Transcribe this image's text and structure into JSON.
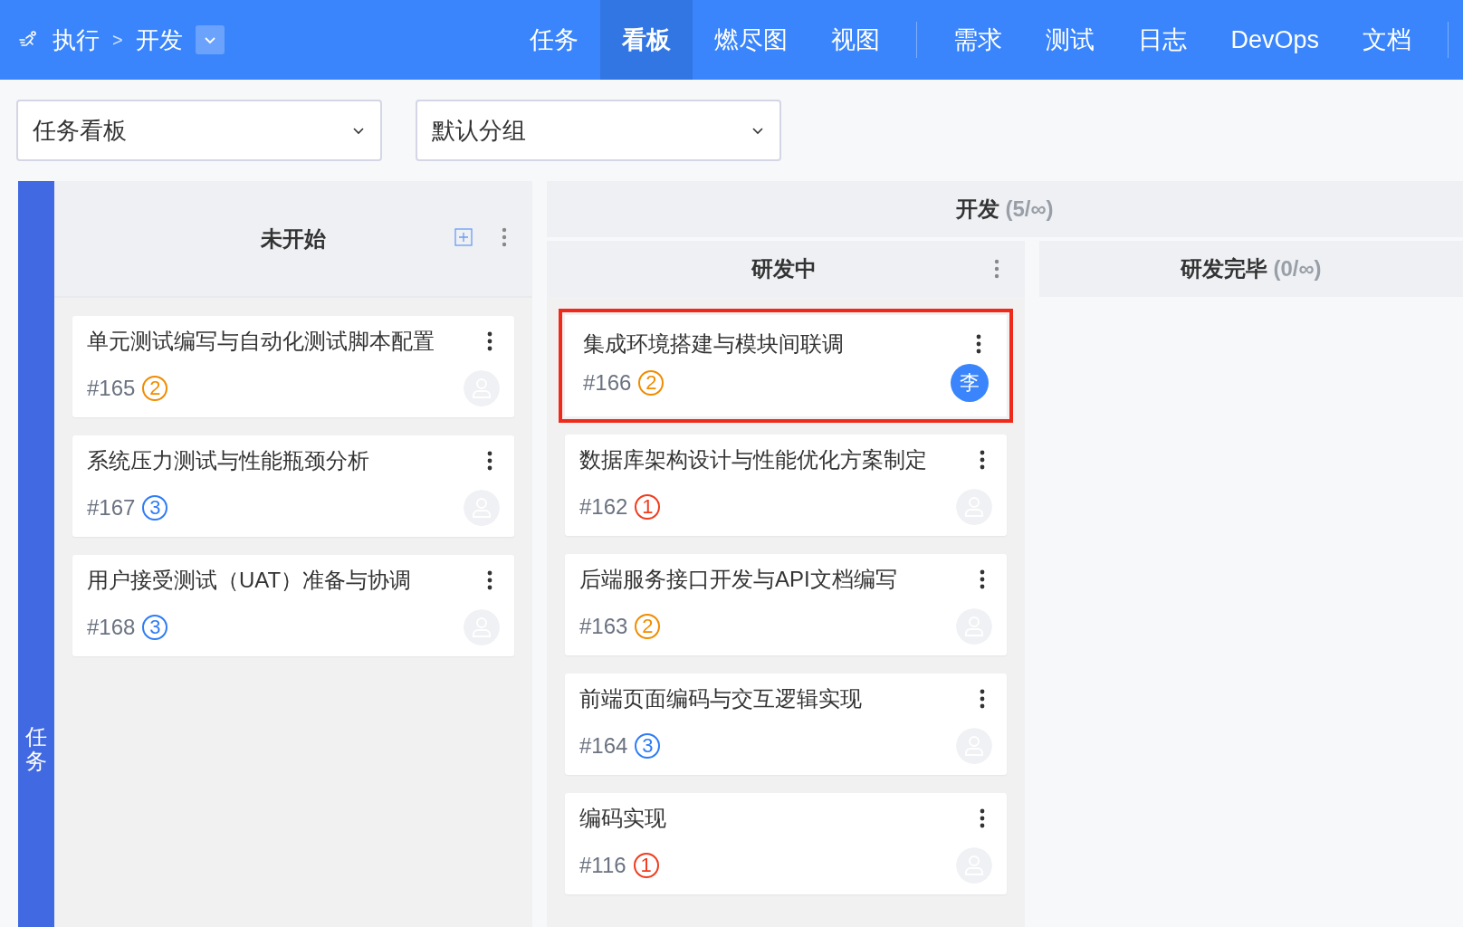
{
  "breadcrumb": {
    "root": "执行",
    "separator": ">",
    "current": "开发"
  },
  "nav_groups": [
    [
      {
        "label": "任务",
        "selected": false
      },
      {
        "label": "看板",
        "selected": true
      },
      {
        "label": "燃尽图",
        "selected": false
      },
      {
        "label": "视图",
        "selected": false
      }
    ],
    [
      {
        "label": "需求",
        "selected": false
      },
      {
        "label": "测试",
        "selected": false
      },
      {
        "label": "日志",
        "selected": false
      },
      {
        "label": "DevOps",
        "selected": false
      },
      {
        "label": "文档",
        "selected": false
      }
    ]
  ],
  "selects": [
    {
      "value": "任务看板"
    },
    {
      "value": "默认分组"
    }
  ],
  "lane": {
    "title": "任务"
  },
  "column": {
    "title": "未开始",
    "cards": [
      {
        "title": "单元测试编写与自动化测试脚本配置",
        "id": "#165",
        "priority": "2",
        "color": "#f08c00",
        "highlighted": false
      },
      {
        "title": "系统压力测试与性能瓶颈分析",
        "id": "#167",
        "priority": "3",
        "color": "#2e7cf6",
        "highlighted": false
      },
      {
        "title": "用户接受测试（UAT）准备与协调",
        "id": "#168",
        "priority": "3",
        "color": "#2e7cf6",
        "highlighted": false
      }
    ]
  },
  "group": {
    "title": "开发",
    "count": "(5/∞)",
    "columns": [
      {
        "title": "研发中",
        "cards": [
          {
            "title": "集成环境搭建与模块间联调",
            "id": "#166",
            "priority": "2",
            "color": "#f08c00",
            "assignee": "李",
            "highlighted": true
          },
          {
            "title": "数据库架构设计与性能优化方案制定",
            "id": "#162",
            "priority": "1",
            "color": "#f03c1e",
            "highlighted": false
          },
          {
            "title": "后端服务接口开发与API文档编写",
            "id": "#163",
            "priority": "2",
            "color": "#f08c00",
            "highlighted": false
          },
          {
            "title": "前端页面编码与交互逻辑实现",
            "id": "#164",
            "priority": "3",
            "color": "#2e7cf6",
            "highlighted": false
          },
          {
            "title": "编码实现",
            "id": "#116",
            "priority": "1",
            "color": "#f03c1e",
            "highlighted": false
          }
        ]
      },
      {
        "title": "研发完毕",
        "count": "(0/∞)"
      }
    ]
  }
}
